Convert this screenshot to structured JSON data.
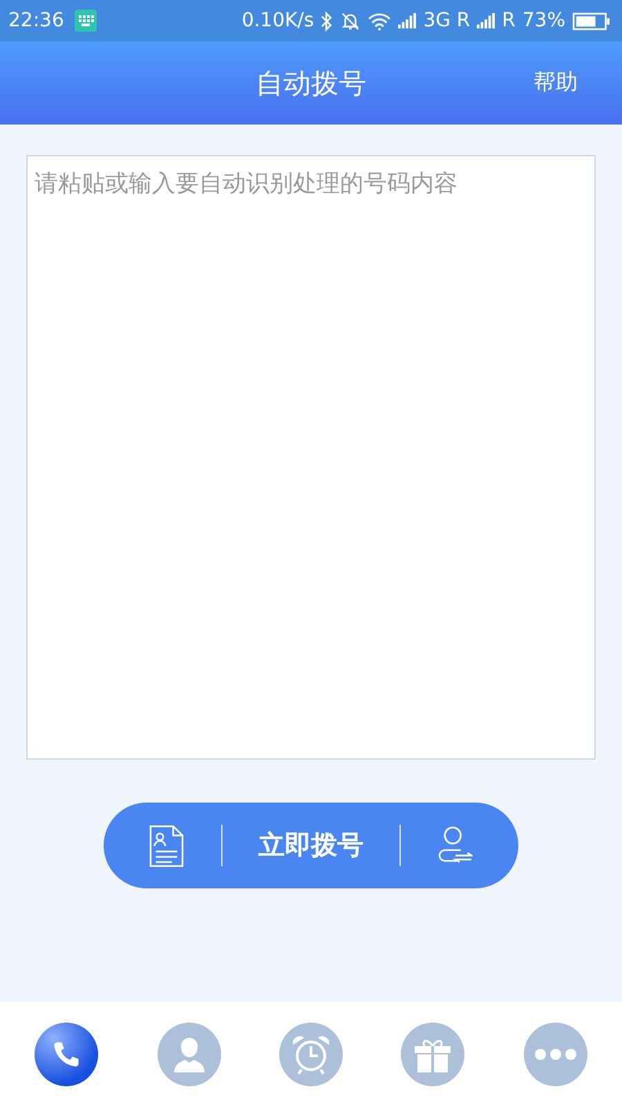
{
  "status_bar": {
    "time": "22:36",
    "speed": "0.10K/s",
    "network_1": "3G R",
    "network_2": "R",
    "battery_text": "73%"
  },
  "header": {
    "title": "自动拨号",
    "help": "帮助"
  },
  "input": {
    "placeholder": "请粘贴或输入要自动识别处理的号码内容"
  },
  "action_bar": {
    "dial_label": "立即拨号"
  },
  "nav": [
    {
      "kind": "phone",
      "selected": true
    },
    {
      "kind": "contact",
      "selected": false
    },
    {
      "kind": "alarm",
      "selected": false
    },
    {
      "kind": "gift",
      "selected": false
    },
    {
      "kind": "more",
      "selected": false
    }
  ]
}
